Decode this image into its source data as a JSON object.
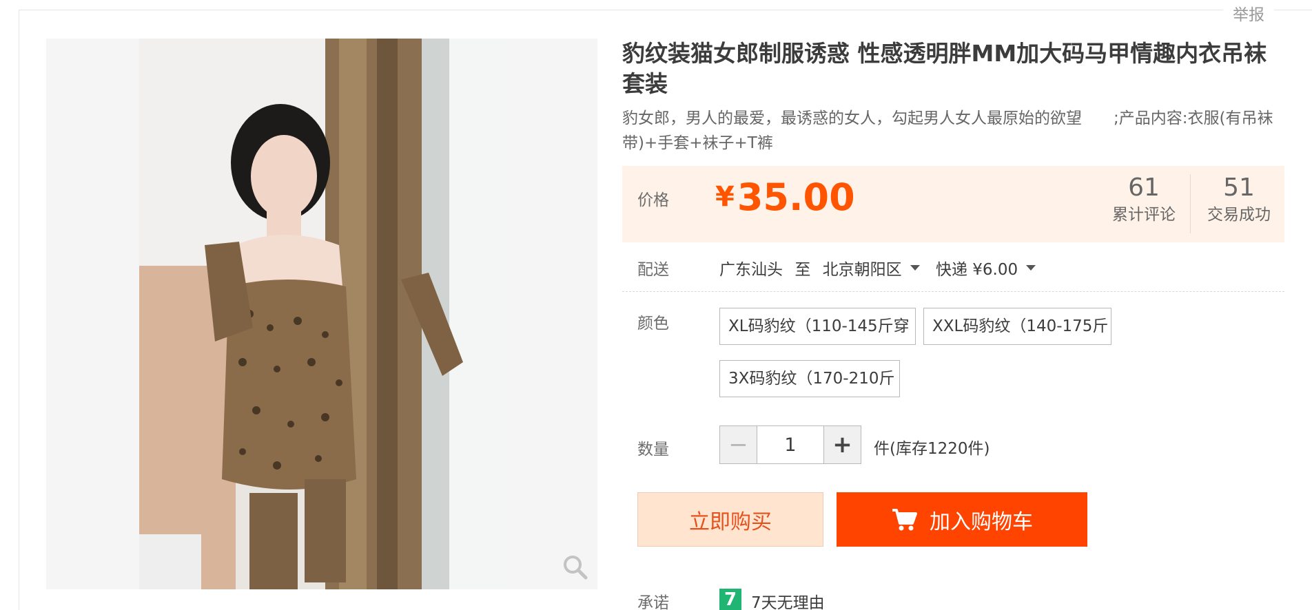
{
  "report_label": "举报",
  "product": {
    "title": "豹纹装猫女郎制服诱惑 性感透明胖MM加大码马甲情趣内衣吊袜套装",
    "subtitle": "豹女郎，男人的最爱，最诱惑的女人，勾起男人女人最原始的欲望　　;产品内容:衣服(有吊袜带)+手套+袜子+T裤"
  },
  "price": {
    "label": "价格",
    "currency": "¥",
    "value": "35.00",
    "accent_color": "#ff5500",
    "reviews_count": "61",
    "reviews_label": "累计评论",
    "sales_count": "51",
    "sales_label": "交易成功"
  },
  "shipping": {
    "label": "配送",
    "origin": "广东汕头",
    "to": "至",
    "destination": "北京朝阳区",
    "method": "快递 ¥6.00"
  },
  "color": {
    "label": "颜色",
    "options": [
      "XL码豹纹（110-145斤穿",
      "XXL码豹纹（140-175斤",
      "3X码豹纹（170-210斤"
    ]
  },
  "quantity": {
    "label": "数量",
    "minus": "−",
    "value": "1",
    "plus": "+",
    "stock": "件(库存1220件)"
  },
  "actions": {
    "buy_now": "立即购买",
    "add_to_cart": "加入购物车",
    "add_to_cart_color": "#ff4400"
  },
  "promise": {
    "label": "承诺",
    "badge": "7",
    "text": "7天无理由"
  },
  "icons": {
    "zoom": "magnifier-icon",
    "cart": "cart-icon",
    "dropdown": "caret-down-icon"
  }
}
